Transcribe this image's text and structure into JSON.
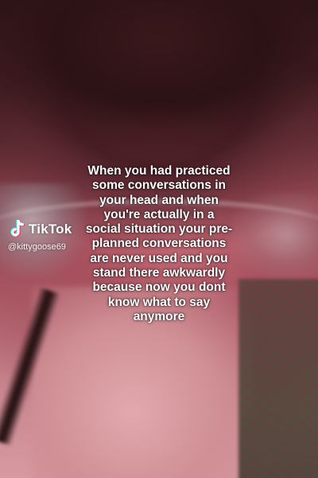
{
  "watermark": {
    "brand": "TikTok",
    "handle": "@kittygoose69",
    "icon": "tiktok-note-icon"
  },
  "caption": {
    "lines": [
      "When you had practiced",
      "some conversations in",
      "your head and when",
      "you're actually in a",
      "social situation your pre-",
      "planned conversations",
      "are never used and you",
      "stand there awkwardly",
      "because now you dont",
      "know what to say",
      "anymore"
    ]
  },
  "colors": {
    "text": "#ffffff",
    "tiktok_cyan": "#25F4EE",
    "tiktok_red": "#FE2C55"
  }
}
